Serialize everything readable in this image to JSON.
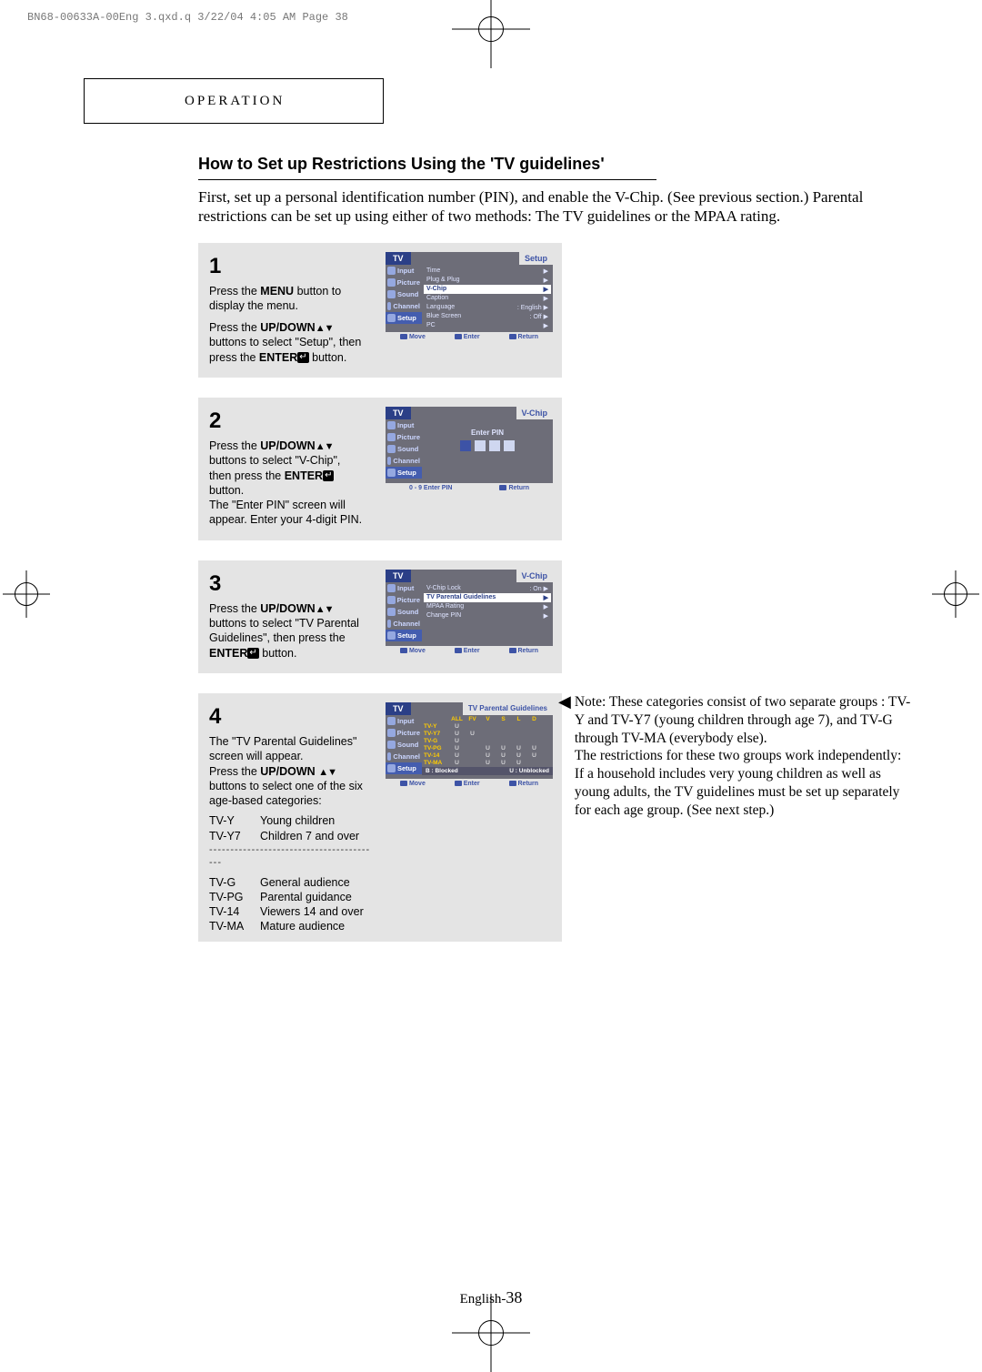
{
  "doc_header": "BN68-00633A-00Eng 3.qxd.q  3/22/04 4:05 AM  Page 38",
  "section_label": "OPERATION",
  "heading": "How to Set up Restrictions Using the 'TV guidelines'",
  "intro": "First, set up a personal identification number (PIN), and enable the V-Chip. (See previous section.) Parental restrictions can be set up using either of two methods: The TV guidelines or the MPAA rating.",
  "steps": {
    "s1": {
      "num": "1",
      "p1a": "Press the ",
      "p1b": "MENU",
      "p1c": " button to display the menu.",
      "p2a": "Press the ",
      "p2b": "UP/DOWN",
      "p2c": " buttons to select \"Setup\", then press the ",
      "p2d": "ENTER",
      "p2e": " button."
    },
    "s2": {
      "num": "2",
      "p1a": "Press the ",
      "p1b": "UP/DOWN",
      "p1c": " buttons to select  \"V-Chip\", then press the ",
      "p1d": "ENTER",
      "p1e": " button.",
      "p2": "The \"Enter PIN\" screen will appear. Enter your 4-digit PIN."
    },
    "s3": {
      "num": "3",
      "p1a": "Press the ",
      "p1b": "UP/DOWN",
      "p1c": " buttons to select \"TV Parental Guidelines\", then press the ",
      "p1d": "ENTER",
      "p1e": " button."
    },
    "s4": {
      "num": "4",
      "p1": "The \"TV Parental Guidelines\" screen will appear.",
      "p2a": "Press the ",
      "p2b": "UP/DOWN",
      "p2c": " buttons to select one of the six age-based categories:"
    }
  },
  "categories": [
    {
      "code": "TV-Y",
      "desc": "Young children"
    },
    {
      "code": "TV-Y7",
      "desc": "Children 7 and over"
    }
  ],
  "categories2": [
    {
      "code": "TV-G",
      "desc": "General audience"
    },
    {
      "code": "TV-PG",
      "desc": "Parental guidance"
    },
    {
      "code": "TV-14",
      "desc": "Viewers 14 and over"
    },
    {
      "code": "TV-MA",
      "desc": "Mature audience"
    }
  ],
  "dotline": "-----------------------------------------",
  "note": "Note: These categories consist of two separate groups : TV-Y and TV-Y7 (young children through age 7), and TV-G through TV-MA (everybody else). \nThe restrictions for these two groups work independently: \nIf a household includes very young children as well as young adults, the TV guidelines must be set up separately for each age group. (See next step.)",
  "osd": {
    "tv": "TV",
    "side": {
      "input": "Input",
      "picture": "Picture",
      "sound": "Sound",
      "channel": "Channel",
      "setup": "Setup"
    },
    "footer": {
      "move": "Move",
      "enter": "Enter",
      "return": "Return"
    },
    "screen1": {
      "title": "Setup",
      "rows": [
        {
          "l": "Time",
          "r": "",
          "sel": false
        },
        {
          "l": "Plug & Plug",
          "r": "",
          "sel": false
        },
        {
          "l": "V-Chip",
          "r": "",
          "sel": true
        },
        {
          "l": "Caption",
          "r": "",
          "sel": false
        },
        {
          "l": "Language",
          "r": ": English",
          "sel": false
        },
        {
          "l": "Blue Screen",
          "r": ": Off",
          "sel": false
        },
        {
          "l": "PC",
          "r": "",
          "sel": false
        }
      ]
    },
    "screen2": {
      "title": "V-Chip",
      "enterpin": "Enter PIN",
      "footerHint": "0 - 9 Enter PIN"
    },
    "screen3": {
      "title": "V-Chip",
      "rows": [
        {
          "l": "V-Chip Lock",
          "r": ": On",
          "sel": false
        },
        {
          "l": "TV Parental Guidelines",
          "r": "",
          "sel": true
        },
        {
          "l": "MPAA Rating",
          "r": "",
          "sel": false
        },
        {
          "l": "Change PIN",
          "r": "",
          "sel": false
        }
      ]
    },
    "screen4": {
      "title": "TV Parental Guidelines",
      "cols": [
        "ALL",
        "FV",
        "V",
        "S",
        "L",
        "D"
      ],
      "rows": [
        {
          "lbl": "TV-Y",
          "cells": [
            "U",
            "",
            "",
            "",
            "",
            ""
          ]
        },
        {
          "lbl": "TV-Y7",
          "cells": [
            "U",
            "U",
            "",
            "",
            "",
            ""
          ]
        },
        {
          "lbl": "TV-G",
          "cells": [
            "U",
            "",
            "",
            "",
            "",
            ""
          ]
        },
        {
          "lbl": "TV-PG",
          "cells": [
            "U",
            "",
            "U",
            "U",
            "U",
            "U"
          ]
        },
        {
          "lbl": "TV-14",
          "cells": [
            "U",
            "",
            "U",
            "U",
            "U",
            "U"
          ]
        },
        {
          "lbl": "TV-MA",
          "cells": [
            "U",
            "",
            "U",
            "U",
            "U",
            ""
          ]
        }
      ],
      "legendB": "B : Blocked",
      "legendU": "U : Unblocked"
    }
  },
  "footer": {
    "label": "English-",
    "num": "38"
  }
}
